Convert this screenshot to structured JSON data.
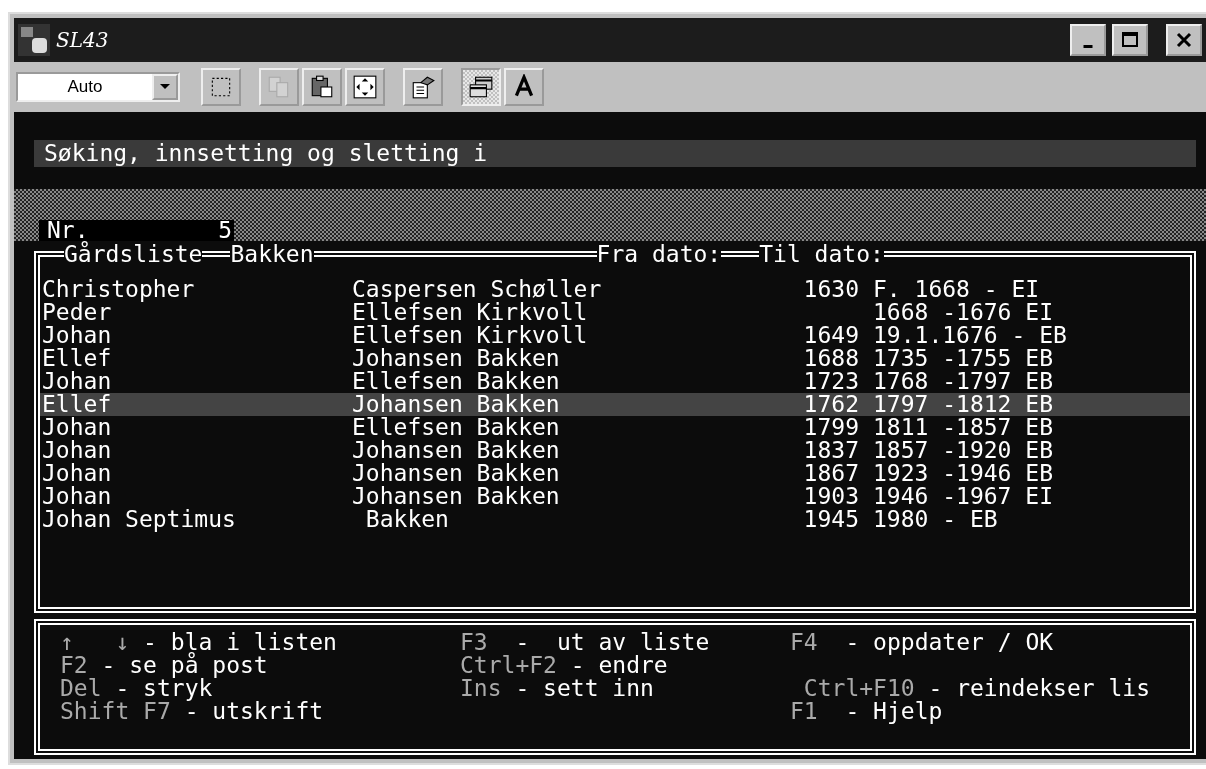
{
  "window": {
    "title": "SL43"
  },
  "toolbar": {
    "font_size": "Auto",
    "buttons": [
      {
        "kind": "mark",
        "disabled": false,
        "pressed": false
      },
      {
        "kind": "copy",
        "disabled": true,
        "pressed": false
      },
      {
        "kind": "paste",
        "disabled": false,
        "pressed": false
      },
      {
        "kind": "fullscreen",
        "disabled": false,
        "pressed": false
      },
      {
        "kind": "properties",
        "disabled": false,
        "pressed": false
      },
      {
        "kind": "background",
        "disabled": false,
        "pressed": true
      },
      {
        "kind": "font",
        "disabled": false,
        "pressed": false
      }
    ]
  },
  "header": "Søking, innsetting og sletting i",
  "record": {
    "label": "Nr.",
    "value": "5"
  },
  "list": {
    "title": "Gårdsliste",
    "farm": "Bakken",
    "from_label": "Fra dato:",
    "to_label": "Til dato:",
    "rows": [
      {
        "first": "Christopher",
        "last": "Caspersen Schøller",
        "year": "1630",
        "period": "F. 1668 - EI",
        "selected": false
      },
      {
        "first": "Peder",
        "last": "Ellefsen Kirkvoll",
        "period": "1668 -1676 EI",
        "selected": false
      },
      {
        "first": "Johan",
        "last": "Ellefsen Kirkvoll",
        "year": "1649",
        "period": "19.1.1676 - EB",
        "selected": false
      },
      {
        "first": "Ellef",
        "last": "Johansen Bakken",
        "year": "1688",
        "period": "1735 -1755 EB",
        "selected": false
      },
      {
        "first": "Johan",
        "last": "Ellefsen Bakken",
        "year": "1723",
        "period": "1768 -1797 EB",
        "selected": false
      },
      {
        "first": "Ellef",
        "last": "Johansen Bakken",
        "year": "1762",
        "period": "1797 -1812 EB",
        "selected": true
      },
      {
        "first": "Johan",
        "last": "Ellefsen Bakken",
        "year": "1799",
        "period": "1811 -1857 EB",
        "selected": false
      },
      {
        "first": "Johan",
        "last": "Johansen Bakken",
        "year": "1837",
        "period": "1857 -1920 EB",
        "selected": false
      },
      {
        "first": "Johan",
        "last": "Johansen Bakken",
        "year": "1867",
        "period": "1923 -1946 EB",
        "selected": false
      },
      {
        "first": "Johan",
        "last": "Johansen Bakken",
        "year": "1903",
        "period": "1946 -1967 EI",
        "selected": false
      },
      {
        "first": "Johan Septimus",
        "last": " Bakken",
        "year": "1945",
        "period": "1980 - EB",
        "selected": false
      }
    ]
  },
  "help": [
    {
      "column_1": {
        "key": "↑   ↓",
        "text": " - bla i listen"
      },
      "column_2": {
        "key": "F3",
        "text": "  -  ut av liste"
      },
      "column_3": {
        "key": "F4",
        "text": "  - oppdater / OK"
      }
    },
    {
      "column_1": {
        "key": "F2",
        "text": " - se på post"
      },
      "column_2": {
        "key": "Ctrl+F2",
        "text": " - endre"
      }
    },
    {
      "column_1": {
        "key": "Del",
        "text": " - stryk"
      },
      "column_2": {
        "key": "Ins",
        "text": " - sett inn"
      },
      "column_3": {
        "key": " Ctrl+F10",
        "text": " - reindekser lis"
      }
    },
    {
      "column_1": {
        "key": "Shift F7",
        "text": " - utskrift"
      },
      "column_3": {
        "key": "F1",
        "text": "  - Hjelp"
      }
    }
  ]
}
